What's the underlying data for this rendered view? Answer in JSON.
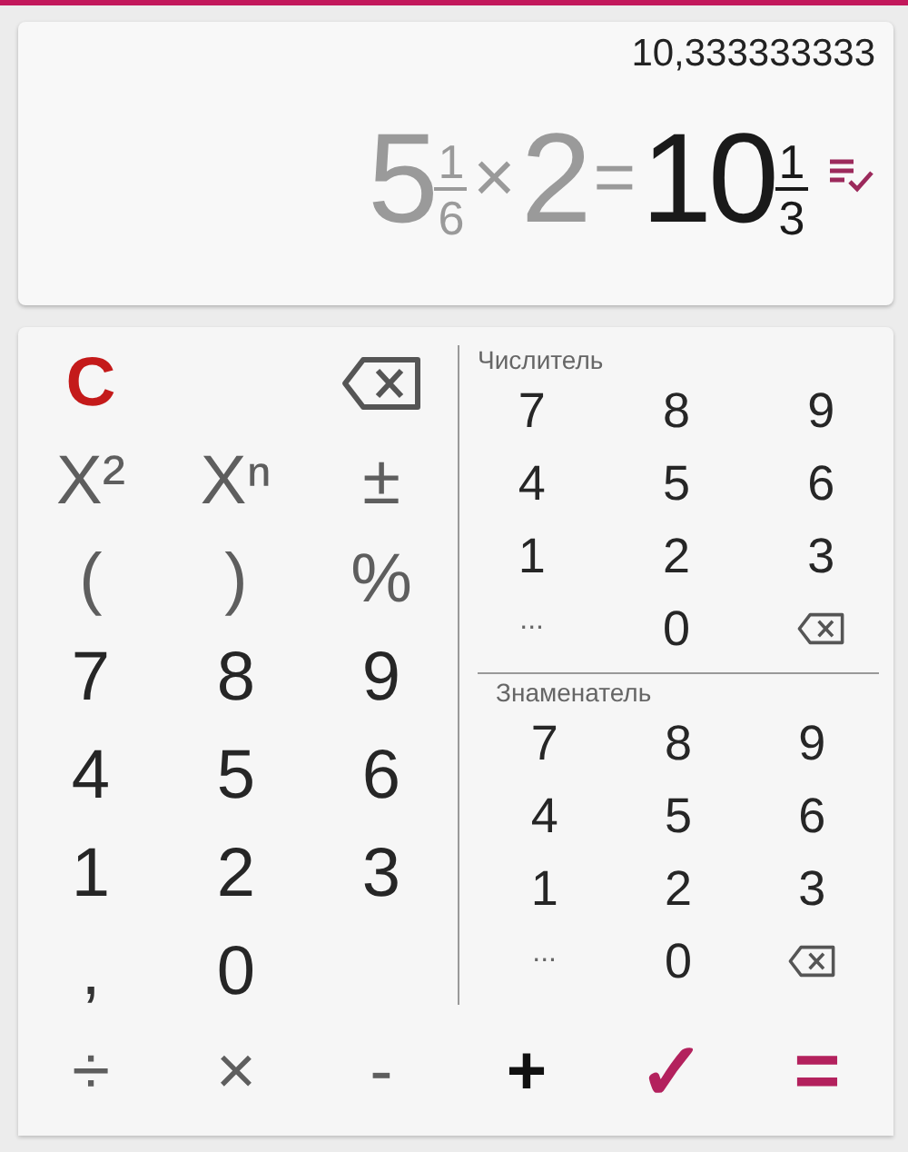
{
  "display": {
    "decimal": "10,333333333",
    "expression": [
      {
        "kind": "mixed",
        "whole": "5",
        "numerator": "1",
        "denominator": "6",
        "result": false
      },
      {
        "kind": "operator",
        "text": "×",
        "result": false
      },
      {
        "kind": "number",
        "text": "2",
        "result": false
      },
      {
        "kind": "operator",
        "text": "=",
        "result": false
      },
      {
        "kind": "mixed",
        "whole": "10",
        "numerator": "1",
        "denominator": "3",
        "result": true
      }
    ]
  },
  "main_keys": [
    {
      "kind": "clear",
      "label": "C"
    },
    {
      "kind": "blank"
    },
    {
      "kind": "backspace"
    },
    {
      "kind": "function",
      "label": "X²"
    },
    {
      "kind": "function",
      "label": "Xⁿ"
    },
    {
      "kind": "function",
      "label": "±"
    },
    {
      "kind": "function",
      "label": "("
    },
    {
      "kind": "function",
      "label": ")"
    },
    {
      "kind": "function",
      "label": "%"
    },
    {
      "kind": "digit",
      "label": "7"
    },
    {
      "kind": "digit",
      "label": "8"
    },
    {
      "kind": "digit",
      "label": "9"
    },
    {
      "kind": "digit",
      "label": "4"
    },
    {
      "kind": "digit",
      "label": "5"
    },
    {
      "kind": "digit",
      "label": "6"
    },
    {
      "kind": "digit",
      "label": "1"
    },
    {
      "kind": "digit",
      "label": "2"
    },
    {
      "kind": "digit",
      "label": "3"
    },
    {
      "kind": "comma",
      "label": ","
    },
    {
      "kind": "digit",
      "label": "0"
    },
    {
      "kind": "blank"
    }
  ],
  "fraction_pads": [
    {
      "label": "Числитель",
      "keys": [
        {
          "kind": "digit",
          "label": "7"
        },
        {
          "kind": "digit",
          "label": "8"
        },
        {
          "kind": "digit",
          "label": "9"
        },
        {
          "kind": "digit",
          "label": "4"
        },
        {
          "kind": "digit",
          "label": "5"
        },
        {
          "kind": "digit",
          "label": "6"
        },
        {
          "kind": "digit",
          "label": "1"
        },
        {
          "kind": "digit",
          "label": "2"
        },
        {
          "kind": "digit",
          "label": "3"
        },
        {
          "kind": "more",
          "label": "..."
        },
        {
          "kind": "digit",
          "label": "0"
        },
        {
          "kind": "backspace"
        }
      ]
    },
    {
      "label": "Знаменатель",
      "keys": [
        {
          "kind": "digit",
          "label": "7"
        },
        {
          "kind": "digit",
          "label": "8"
        },
        {
          "kind": "digit",
          "label": "9"
        },
        {
          "kind": "digit",
          "label": "4"
        },
        {
          "kind": "digit",
          "label": "5"
        },
        {
          "kind": "digit",
          "label": "6"
        },
        {
          "kind": "digit",
          "label": "1"
        },
        {
          "kind": "digit",
          "label": "2"
        },
        {
          "kind": "digit",
          "label": "3"
        },
        {
          "kind": "more",
          "label": "..."
        },
        {
          "kind": "digit",
          "label": "0"
        },
        {
          "kind": "backspace"
        }
      ]
    }
  ],
  "bottom_keys": [
    {
      "kind": "function",
      "label": "÷"
    },
    {
      "kind": "function",
      "label": "×"
    },
    {
      "kind": "function",
      "label": "-"
    },
    {
      "kind": "strong",
      "label": "+"
    },
    {
      "kind": "accent",
      "label": "✓"
    },
    {
      "kind": "accent",
      "label": "="
    }
  ]
}
